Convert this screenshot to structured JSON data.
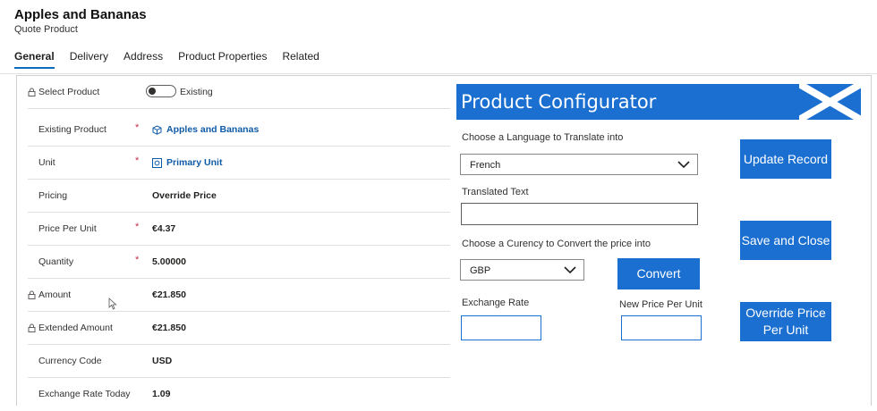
{
  "header": {
    "title": "Apples and Bananas",
    "subtitle": "Quote Product"
  },
  "tabs": [
    {
      "label": "General",
      "active": true
    },
    {
      "label": "Delivery"
    },
    {
      "label": "Address"
    },
    {
      "label": "Product Properties"
    },
    {
      "label": "Related"
    }
  ],
  "form": {
    "select_product": {
      "label": "Select Product",
      "toggle_label": "Existing"
    },
    "existing_product": {
      "label": "Existing Product",
      "required": "*",
      "value": "Apples and Bananas"
    },
    "unit": {
      "label": "Unit",
      "required": "*",
      "value": "Primary Unit"
    },
    "pricing": {
      "label": "Pricing",
      "value": "Override Price"
    },
    "price_per_unit": {
      "label": "Price Per Unit",
      "required": "*",
      "value": "€4.37"
    },
    "quantity": {
      "label": "Quantity",
      "required": "*",
      "value": "5.00000"
    },
    "amount": {
      "label": "Amount",
      "value": "€21.850"
    },
    "extended_amount": {
      "label": "Extended Amount",
      "value": "€21.850"
    },
    "currency_code": {
      "label": "Currency Code",
      "value": "USD"
    },
    "exchange_rate_today": {
      "label": "Exchange Rate Today",
      "value": "1.09"
    }
  },
  "configurator": {
    "title": "Product Configurator",
    "language_label": "Choose a Language to Translate into",
    "language_value": "French",
    "translated_label": "Translated Text",
    "translated_value": "",
    "currency_label": "Choose a Curency to Convert the price into",
    "currency_value": "GBP",
    "convert_button": "Convert",
    "exchange_rate_label": "Exchange Rate",
    "exchange_rate_value": "",
    "new_price_label": "New Price Per Unit",
    "new_price_value": "",
    "update_button": "Update Record",
    "save_close_button": "Save and Close",
    "override_button": "Override Price Per Unit"
  },
  "colors": {
    "accent": "#1a6fd0",
    "link": "#0f5ba7",
    "required": "#c4314b"
  },
  "icons": {
    "lock": "lock-icon",
    "product": "product-cube-icon",
    "unit": "unit-icon",
    "flag": "scotland-flag-icon",
    "chevron": "chevron-down-icon"
  }
}
